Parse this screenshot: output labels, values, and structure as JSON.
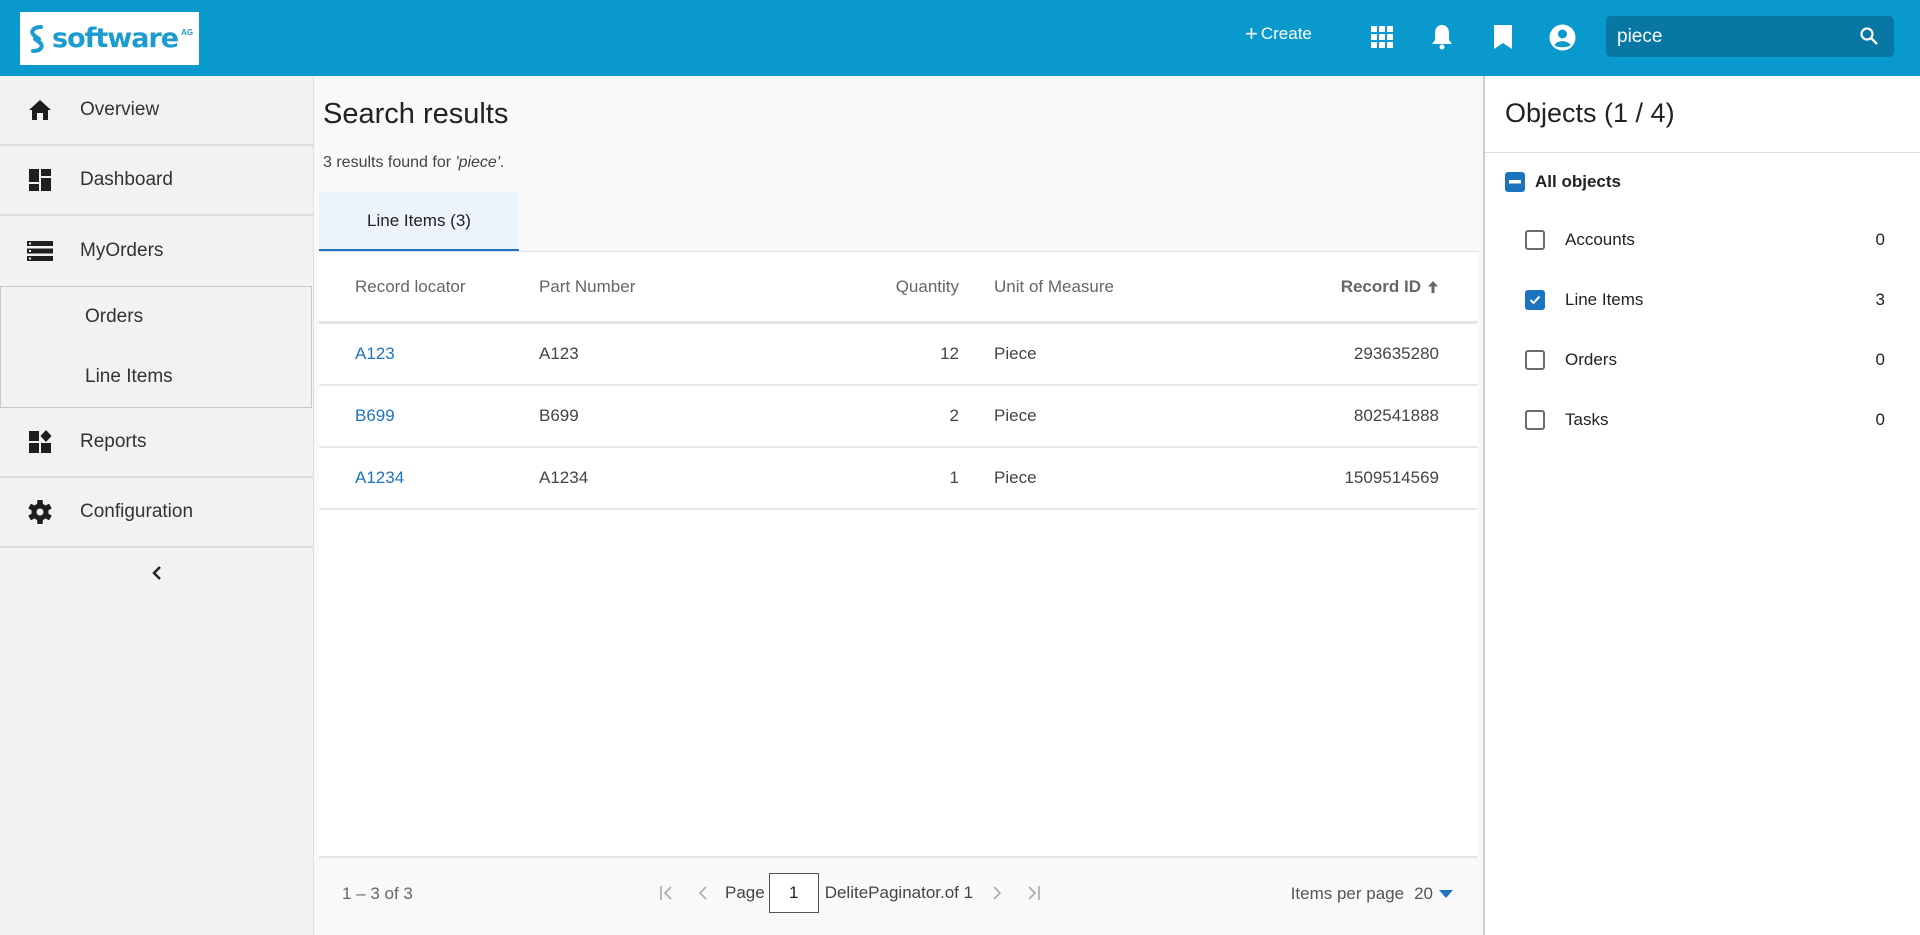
{
  "header": {
    "logo_text": "software",
    "logo_suffix": "AG",
    "create_label": "Create",
    "search_value": "piece",
    "brand_color": "#0a99cd",
    "icons": [
      "apps-grid-icon",
      "bell-icon",
      "bookmark-icon",
      "account-circle-icon",
      "search-icon"
    ]
  },
  "sidebar": {
    "items": [
      {
        "label": "Overview",
        "icon": "home-icon"
      },
      {
        "label": "Dashboard",
        "icon": "dashboard-icon"
      },
      {
        "label": "MyOrders",
        "icon": "list-icon"
      },
      {
        "label": "Reports",
        "icon": "widgets-icon"
      },
      {
        "label": "Configuration",
        "icon": "gear-icon"
      }
    ],
    "subitems": [
      {
        "label": "Orders"
      },
      {
        "label": "Line Items"
      }
    ],
    "collapse_icon": "chevron-left-icon"
  },
  "main": {
    "title": "Search results",
    "results_prefix": "3 results found for ",
    "results_query": "'piece'",
    "results_suffix": ".",
    "tab_label": "Line Items (3)",
    "table": {
      "headers": [
        "Record locator",
        "Part Number",
        "Quantity",
        "Unit of Measure",
        "Record ID"
      ],
      "sort_column": "Record ID",
      "sort_direction": "ascending",
      "rows": [
        {
          "record_locator": "A123",
          "part_number": "A123",
          "quantity": "12",
          "unit": "Piece",
          "record_id": "293635280"
        },
        {
          "record_locator": "B699",
          "part_number": "B699",
          "quantity": "2",
          "unit": "Piece",
          "record_id": "802541888"
        },
        {
          "record_locator": "A1234",
          "part_number": "A1234",
          "quantity": "1",
          "unit": "Piece",
          "record_id": "1509514569"
        }
      ]
    },
    "paginator": {
      "range": "1 – 3 of 3",
      "page_label": "Page",
      "page_value": "1",
      "of_label": "DelitePaginator.of 1",
      "items_per_page_label": "Items per page",
      "items_per_page_value": "20"
    }
  },
  "right_panel": {
    "title": "Objects (1 / 4)",
    "all_label": "All objects",
    "all_state": "indeterminate",
    "objects": [
      {
        "label": "Accounts",
        "count": "0",
        "checked": false
      },
      {
        "label": "Line Items",
        "count": "3",
        "checked": true
      },
      {
        "label": "Orders",
        "count": "0",
        "checked": false
      },
      {
        "label": "Tasks",
        "count": "0",
        "checked": false
      }
    ],
    "accent_color": "#1c74c1"
  }
}
